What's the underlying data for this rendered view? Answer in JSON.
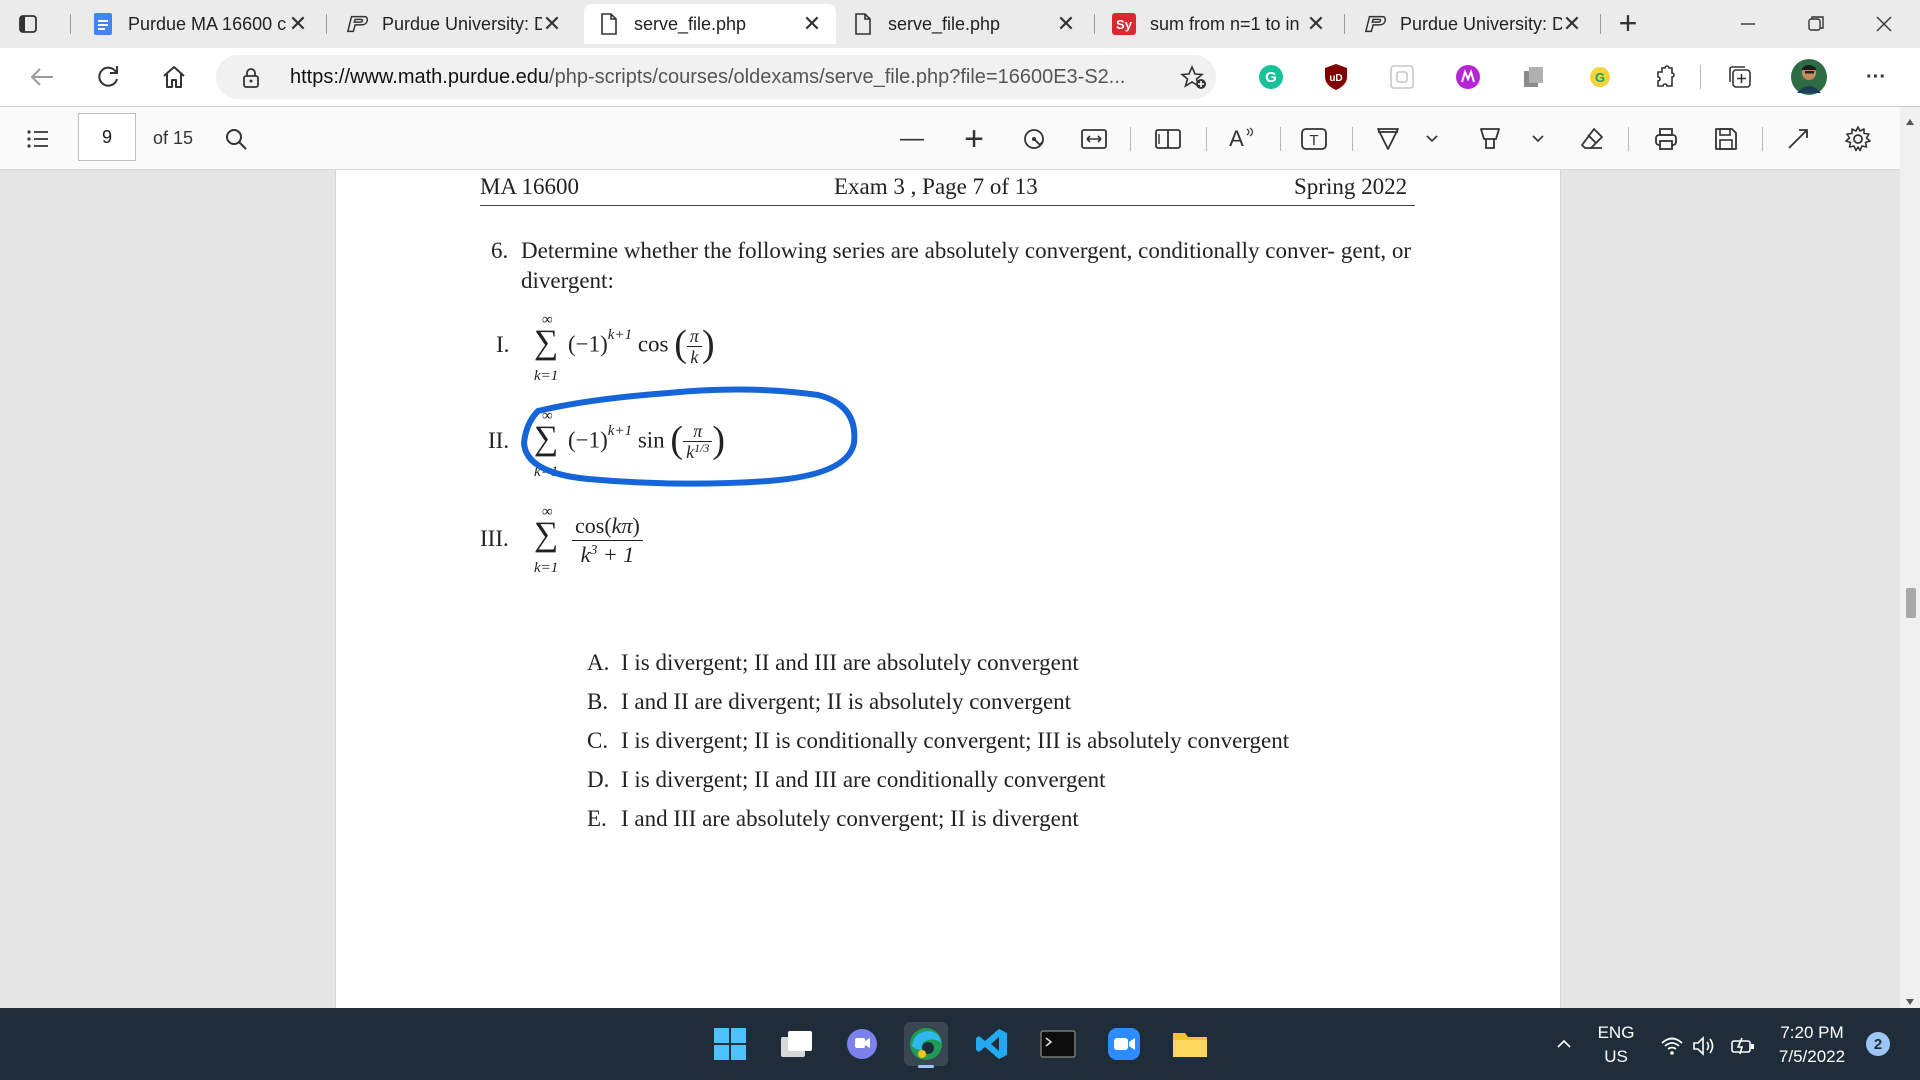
{
  "browser": {
    "tabs": [
      {
        "title": "Purdue MA 16600 c",
        "icon": "google-docs-icon"
      },
      {
        "title": "Purdue University: D",
        "icon": "purdue-p-icon"
      },
      {
        "title": "serve_file.php",
        "icon": "document-icon",
        "active": true
      },
      {
        "title": "serve_file.php",
        "icon": "document-icon"
      },
      {
        "title": "sum from n=1 to in",
        "icon": "symbolab-icon",
        "icon_text": "Sy"
      },
      {
        "title": "Purdue University: D",
        "icon": "purdue-p-icon"
      }
    ],
    "close_glyph": "✕",
    "new_tab_glyph": "+",
    "url_host": "https://www.math.purdue.edu",
    "url_rest": "/php-scripts/courses/oldexams/serve_file.php?file=16600E3-S2...",
    "extension_ub_text": "uD",
    "menu_glyph": "···"
  },
  "pdf_toolbar": {
    "page_number": "9",
    "page_total": "of 15",
    "zoom_out_glyph": "—",
    "zoom_in_glyph": "+",
    "read_aloud_label": "A",
    "text_tool_label": "T"
  },
  "document": {
    "header_left": "MA 16600",
    "header_center": "Exam 3 , Page 7 of 13",
    "header_right": "Spring 2022",
    "question_number": "6.",
    "question_text": "Determine whether the following series are absolutely convergent, conditionally conver- gent, or divergent:",
    "series": [
      {
        "roman": "I.",
        "upper": "∞",
        "lower": "k=1"
      },
      {
        "roman": "II.",
        "upper": "∞",
        "lower": "k=1"
      },
      {
        "roman": "III.",
        "upper": "∞",
        "lower": "k=1"
      }
    ],
    "choices": [
      {
        "letter": "A.",
        "text": "I is divergent; II and III are absolutely convergent"
      },
      {
        "letter": "B.",
        "text": "I and II are divergent; II is absolutely convergent"
      },
      {
        "letter": "C.",
        "text": "I is divergent; II is conditionally convergent; III is absolutely convergent"
      },
      {
        "letter": "D.",
        "text": "I is divergent; II and III are conditionally convergent"
      },
      {
        "letter": "E.",
        "text": "I and III are absolutely convergent; II is divergent"
      }
    ],
    "annotation_color": "#1565d8"
  },
  "taskbar": {
    "language_top": "ENG",
    "language_bottom": "US",
    "time": "7:20 PM",
    "date": "7/5/2022",
    "notification_count": "2"
  }
}
